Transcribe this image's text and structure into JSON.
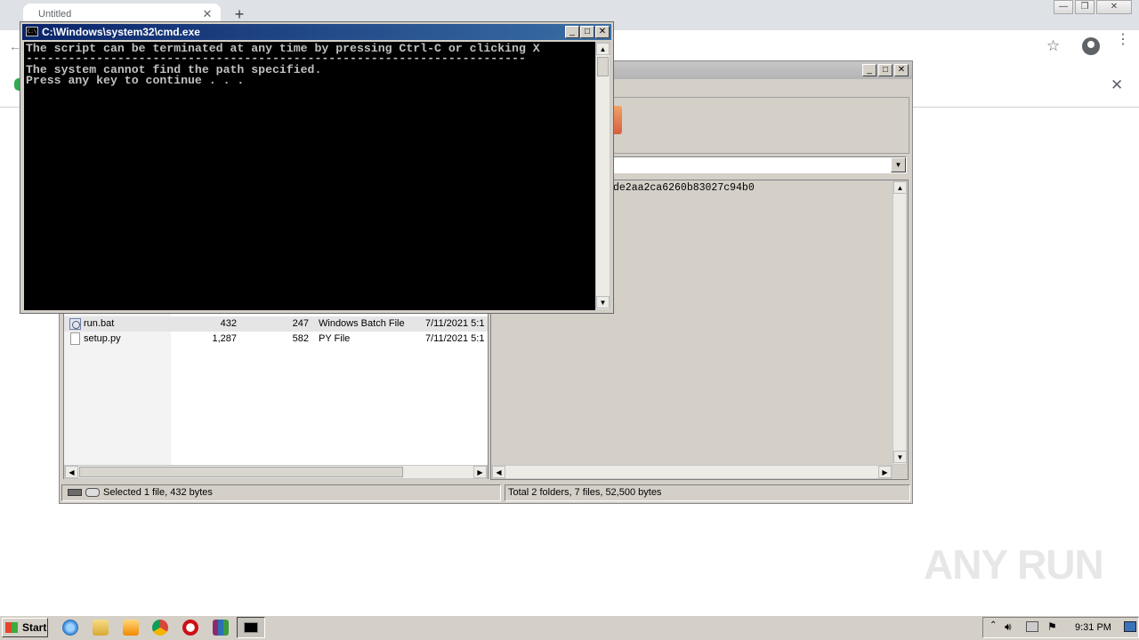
{
  "browser": {
    "tab_title": "Untitled",
    "tab_close": "✕",
    "new_tab": "+",
    "back": "←",
    "star": "☆",
    "menu": "⋮",
    "infobar_close": "✕",
    "window_controls": [
      "—",
      "❐",
      "✕"
    ]
  },
  "winrar": {
    "window_controls": [
      "_",
      "□",
      "✕"
    ],
    "path_dropdown": "▼",
    "info_hash": "de2aa2ca6260b83027c94b0",
    "files": [
      {
        "name": "run.bat",
        "size": "432",
        "packed": "247",
        "type": "Windows Batch File",
        "modified": "7/11/2021 5:1",
        "icon": "batch-file-icon"
      },
      {
        "name": "setup.py",
        "size": "1,287",
        "packed": "582",
        "type": "PY File",
        "modified": "7/11/2021 5:1",
        "icon": "py-file-icon"
      }
    ],
    "status_left": "Selected 1 file, 432 bytes",
    "status_right": "Total 2 folders, 7 files, 52,500 bytes"
  },
  "cmd": {
    "title": "C:\\Windows\\system32\\cmd.exe",
    "icon_text": "C:\\",
    "window_controls": [
      "_",
      "□",
      "✕"
    ],
    "lines": [
      "The script can be terminated at any time by pressing Ctrl-C or clicking X",
      "-----------------------------------------------------------------------",
      "",
      "The system cannot find the path specified.",
      "Press any key to continue . . ."
    ]
  },
  "taskbar": {
    "start_label": "Start",
    "clock": "9:31 PM",
    "icons": [
      "internet-explorer-icon",
      "folder-icon",
      "media-player-icon",
      "chrome-icon",
      "opera-icon",
      "winrar-icon",
      "cmd-icon"
    ]
  },
  "watermark": "ANY RUN",
  "colors": {
    "titlebar_active": "#0a246a",
    "console_bg": "#000000",
    "console_text": "#c0c0c0",
    "classic_gray": "#d4d0c8"
  }
}
